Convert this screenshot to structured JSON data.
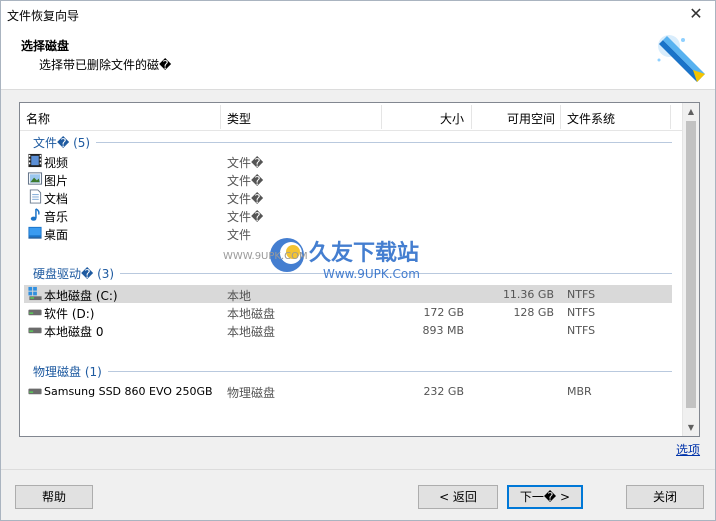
{
  "window": {
    "title": "文件恢复向导",
    "close_glyph": "✕"
  },
  "header": {
    "title": "选择磁盘",
    "subtitle": "选择带已删除文件的磁�"
  },
  "columns": {
    "name": "名称",
    "type": "类型",
    "size": "大小",
    "free": "可用空间",
    "fs": "文件系统"
  },
  "groups": {
    "folders": {
      "label": "文件� (5)"
    },
    "hdd": {
      "label": "硬盘驱动� (3)"
    },
    "physical": {
      "label": "物理磁盘 (1)"
    }
  },
  "folders": [
    {
      "name": "视频",
      "type": "文件�",
      "icon": "video-icon"
    },
    {
      "name": "图片",
      "type": "文件�",
      "icon": "picture-icon"
    },
    {
      "name": "文档",
      "type": "文件�",
      "icon": "document-icon"
    },
    {
      "name": "音乐",
      "type": "文件�",
      "icon": "music-icon"
    },
    {
      "name": "桌面",
      "type": "文件",
      "icon": "desktop-icon"
    }
  ],
  "drives": [
    {
      "name": "本地磁盘 (C:)",
      "type": "本地",
      "size": "",
      "free": "11.36 GB",
      "fs": "NTFS",
      "icon": "windows-drive-icon",
      "selected": true
    },
    {
      "name": "软件 (D:)",
      "type": "本地磁盘",
      "size": "172 GB",
      "free": "128 GB",
      "fs": "NTFS",
      "icon": "drive-icon",
      "selected": false
    },
    {
      "name": "本地磁盘 0",
      "type": "本地磁盘",
      "size": "893 MB",
      "free": "",
      "fs": "NTFS",
      "icon": "drive-icon",
      "selected": false
    }
  ],
  "physical": [
    {
      "name": "Samsung SSD 860 EVO 250GB",
      "type": "物理磁盘",
      "size": "232 GB",
      "free": "",
      "fs": "MBR",
      "icon": "drive-icon"
    }
  ],
  "options_link": "选项",
  "buttons": {
    "help": "帮助",
    "back": "< 返回",
    "next": "下一� >",
    "close": "关闭"
  },
  "watermark": {
    "brand": "久友下载站",
    "url": "Www.9UPK.Com",
    "small": "WWW.9UPK.COM"
  },
  "colors": {
    "accent": "#0078d7",
    "group_text": "#1e5aa0",
    "selected_row": "#d9d9d9"
  }
}
